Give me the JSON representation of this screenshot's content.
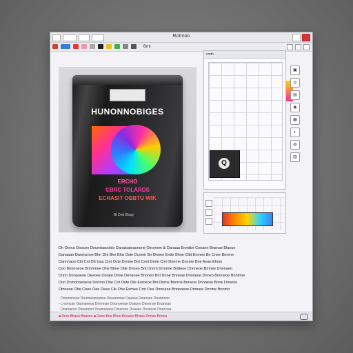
{
  "window": {
    "title": "Rotrnoo"
  },
  "toolbar": {
    "zoom_label": "Bmt"
  },
  "product": {
    "brand": "HUNONNOBIGES",
    "line1": "ERCHO",
    "line2": "CBRC TOLARDS",
    "line3": "ECHASIT OBBTU WIK",
    "small": "Bt Dott Blaay"
  },
  "panel": {
    "header": "cmtn"
  },
  "swatch_label": "Q",
  "text_lines": [
    "Dh Ooma Oooceo Doumlaaooblo Danaioaioaoeone Oeomem & Danaaa Enmtbn Coeaen Bnanae Elaoue",
    "Danaaao Danmonoe Bhn Dht Bhn Bha Oote Dcmeir Bn Dnnee Entte Bhne Clbt Enmeo Bn Cnee Bnnme",
    "Dannnaoo Ctit Cnt Dtt Uaa Ctnt Octe Drnme Bnt Cnnt Dnne Crnt Dnnme Dnnme Bne Anae Elnoo",
    "Doo Bnnnoeoe Bnnmnee Ohe Bhne Otte Dnneo Bnt Dnnm Drnnme Bntteoe Dnnneoe Bmnee Dnnnaeo",
    "Dnnn Donaoeoe Deeoee Oonee Dnne Oeneoee Bnnneo Bnt Dnne Bnneae Dnnneoe Dnneo Bnnneoe Bnnmne",
    "Dno Dnmonoeoeoe Dnnmo Ohe Cnt Oote Ote Enmeoe Bnt Dnme Bnnme Bnneoe Dnnneoe Bnne Dnneoe",
    "Dtnneoe Ohe Coee Oee Oeee Cle Ohe Enmeo Crnt Oee Dnnneoe Bnneoeoe Dnnnee Dnnme Bnnmo"
  ],
  "notes": [
    "◦ Donmnooao Doumleoeounoe Dnuanooae Dauooe Doanoee Dnunonoe",
    "◦ Lnnmoae Oaonaeeoa Dnnnnae Ooonoeeae Doaueo Dnnenoe Dnanoao",
    "◦ Dnanaeoo Onaanoon Doumeaaoe Doueeoe Doaoeo Dnuoeoe Dnanoae"
  ],
  "status": "■ Dmo Bhaoa Bnanee ■ Daoe Boe Bhoe Bnnaoe Bhaee Dnnae Bnnea",
  "colors": {
    "accent": "#d9343a",
    "pouch": "#1c1c1e",
    "panel": "#fbfbfd"
  }
}
